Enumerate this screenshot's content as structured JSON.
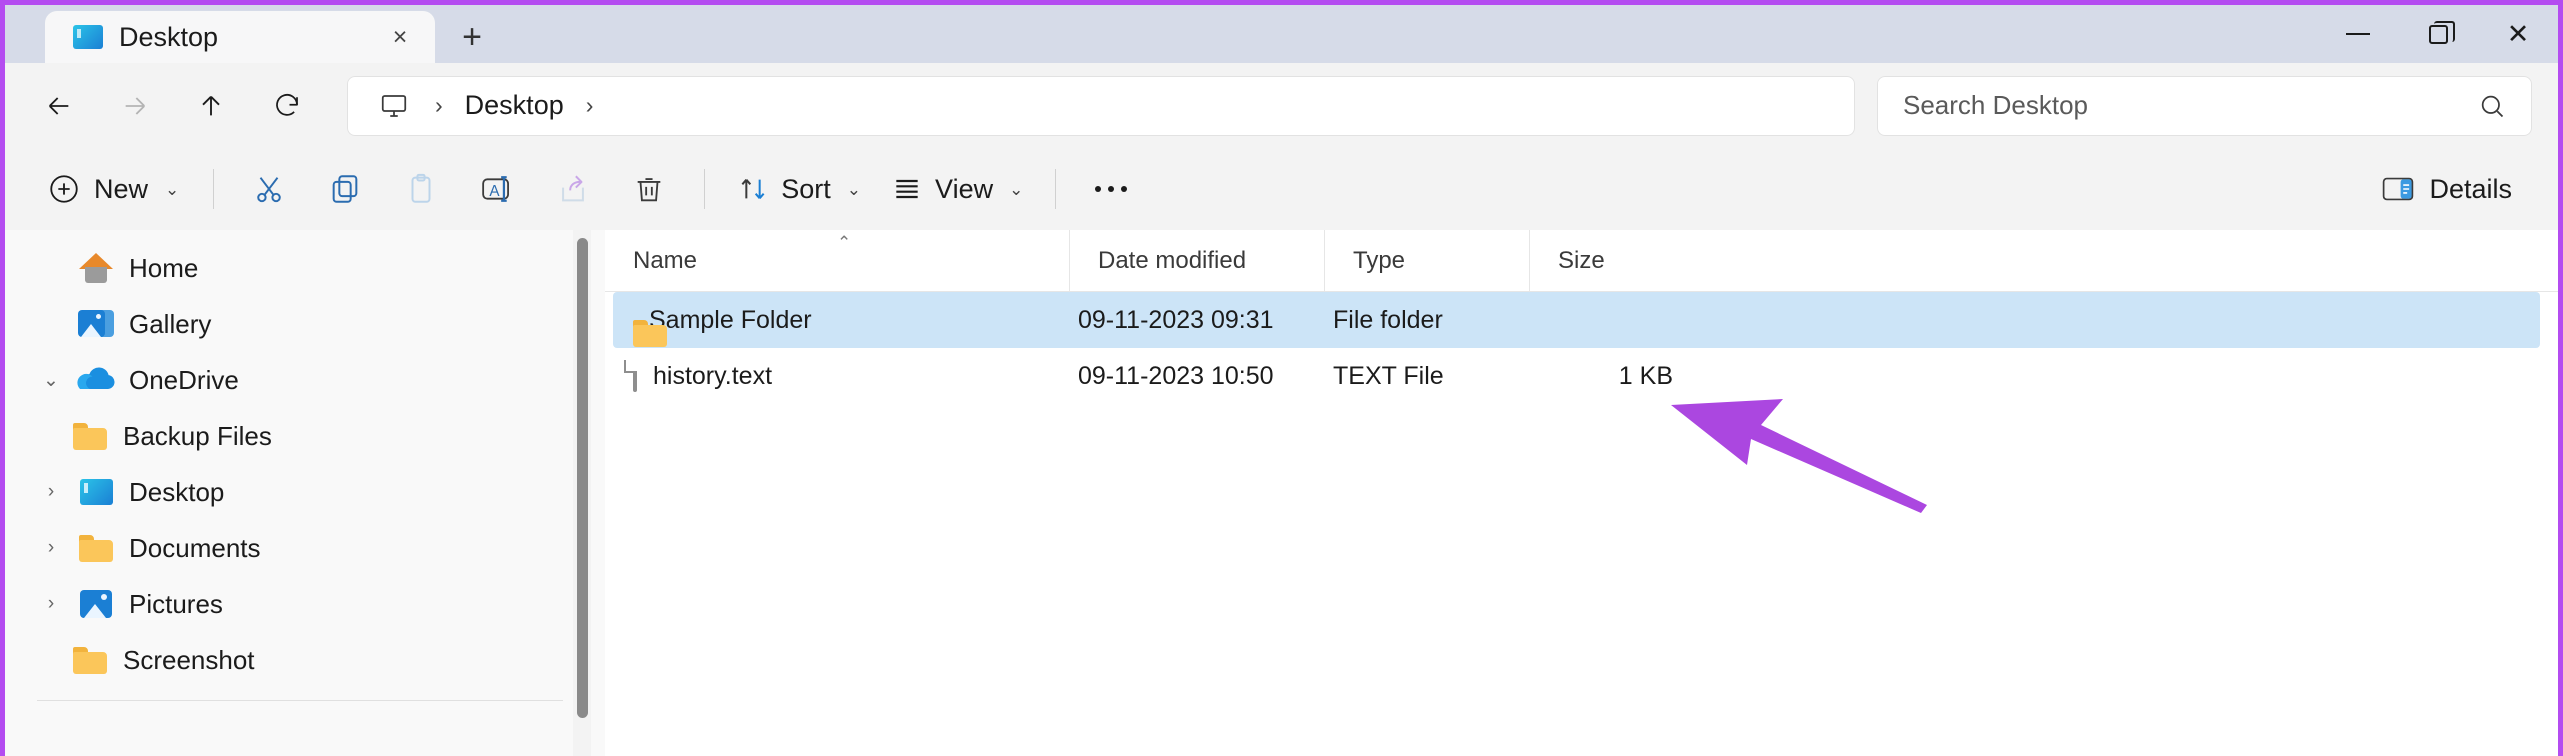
{
  "window": {
    "accent_border_color": "#b44cf0",
    "titlebar_bg": "#d6dbe8",
    "controls": {
      "minimize_label": "Minimize",
      "maximize_label": "Maximize",
      "close_label": "Close"
    }
  },
  "tabs": [
    {
      "title": "Desktop",
      "icon": "desktop-icon",
      "close_label": "×",
      "active": true
    }
  ],
  "new_tab_label": "+",
  "nav": {
    "back_label": "Back",
    "forward_label": "Forward",
    "up_label": "Up",
    "refresh_label": "Refresh"
  },
  "breadcrumb": {
    "root_icon": "this-pc-icon",
    "separator": "›",
    "segments": [
      "Desktop"
    ]
  },
  "search": {
    "placeholder": "Search Desktop",
    "value": "",
    "icon": "search-icon"
  },
  "toolbar": {
    "new_label": "New",
    "new_chevron": "⌄",
    "cut_label": "Cut",
    "copy_label": "Copy",
    "paste_label": "Paste",
    "rename_label": "Rename",
    "share_label": "Share",
    "delete_label": "Delete",
    "sort_label": "Sort",
    "sort_chevron": "⌄",
    "view_label": "View",
    "view_chevron": "⌄",
    "more_label": "See more",
    "details_label": "Details"
  },
  "sidebar": {
    "items": [
      {
        "label": "Home",
        "icon": "home-icon",
        "twisty": "",
        "indent": 0
      },
      {
        "label": "Gallery",
        "icon": "gallery-icon",
        "twisty": "",
        "indent": 0
      },
      {
        "label": "OneDrive",
        "icon": "onedrive-icon",
        "twisty": "⌄",
        "indent": 0
      },
      {
        "label": "Backup Files",
        "icon": "folder-icon",
        "twisty": "",
        "indent": 1
      },
      {
        "label": "Desktop",
        "icon": "desktop-icon",
        "twisty": "›",
        "indent": 1
      },
      {
        "label": "Documents",
        "icon": "folder-icon",
        "twisty": "›",
        "indent": 1
      },
      {
        "label": "Pictures",
        "icon": "pictures-icon",
        "twisty": "›",
        "indent": 1
      },
      {
        "label": "Screenshot",
        "icon": "folder-icon",
        "twisty": "",
        "indent": 1
      }
    ]
  },
  "filelist": {
    "columns": [
      "Name",
      "Date modified",
      "Type",
      "Size"
    ],
    "sort_indicator": "⌃",
    "rows": [
      {
        "name": "Sample Folder",
        "date_modified": "09-11-2023 09:31",
        "type": "File folder",
        "size": "",
        "icon": "folder-icon",
        "selected": true
      },
      {
        "name": "history.text",
        "date_modified": "09-11-2023 10:50",
        "type": "TEXT File",
        "size": "1 KB",
        "icon": "file-icon",
        "selected": false
      }
    ]
  },
  "annotation": {
    "type": "arrow",
    "color": "#ab47e0",
    "points_to": "1 KB"
  }
}
